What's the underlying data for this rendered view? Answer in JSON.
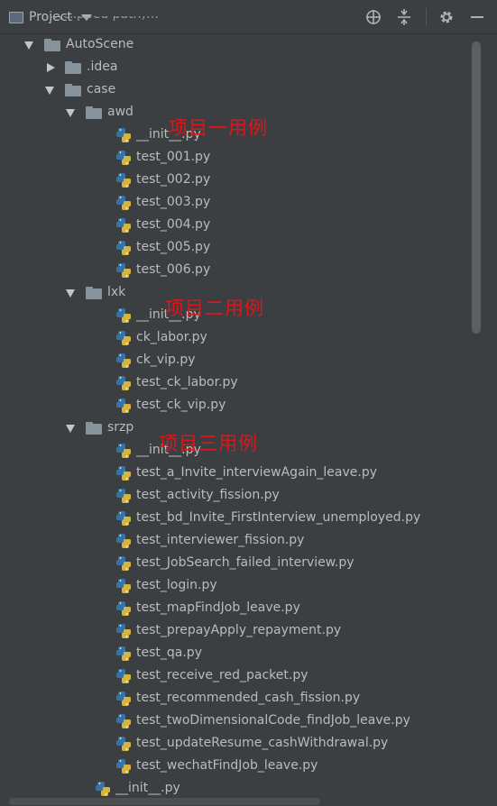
{
  "toolbar": {
    "title": "Project",
    "icons": [
      "crosshair-icon",
      "collapse-icon",
      "gear-icon",
      "minimize-icon"
    ]
  },
  "tree": {
    "hidden_top_row": "…(clipped path)…",
    "rows": [
      {
        "label": "AutoScene",
        "kind": "folder",
        "expanded": true
      },
      {
        "label": ".idea",
        "kind": "folder",
        "expanded": false
      },
      {
        "label": "case",
        "kind": "folder",
        "expanded": true
      },
      {
        "label": "awd",
        "kind": "folder",
        "expanded": true
      },
      {
        "label": "__init__.py",
        "kind": "py"
      },
      {
        "label": "test_001.py",
        "kind": "py"
      },
      {
        "label": "test_002.py",
        "kind": "py"
      },
      {
        "label": "test_003.py",
        "kind": "py"
      },
      {
        "label": "test_004.py",
        "kind": "py"
      },
      {
        "label": "test_005.py",
        "kind": "py"
      },
      {
        "label": "test_006.py",
        "kind": "py"
      },
      {
        "label": "lxk",
        "kind": "folder",
        "expanded": true
      },
      {
        "label": "__init__.py",
        "kind": "py"
      },
      {
        "label": "ck_labor.py",
        "kind": "py"
      },
      {
        "label": "ck_vip.py",
        "kind": "py"
      },
      {
        "label": "test_ck_labor.py",
        "kind": "py"
      },
      {
        "label": "test_ck_vip.py",
        "kind": "py"
      },
      {
        "label": "srzp",
        "kind": "folder",
        "expanded": true
      },
      {
        "label": "__init__.py",
        "kind": "py"
      },
      {
        "label": "test_a_Invite_interviewAgain_leave.py",
        "kind": "py"
      },
      {
        "label": "test_activity_fission.py",
        "kind": "py"
      },
      {
        "label": "test_bd_Invite_FirstInterview_unemployed.py",
        "kind": "py"
      },
      {
        "label": "test_interviewer_fission.py",
        "kind": "py"
      },
      {
        "label": "test_JobSearch_failed_interview.py",
        "kind": "py"
      },
      {
        "label": "test_login.py",
        "kind": "py"
      },
      {
        "label": "test_mapFindJob_leave.py",
        "kind": "py"
      },
      {
        "label": "test_prepayApply_repayment.py",
        "kind": "py"
      },
      {
        "label": "test_qa.py",
        "kind": "py"
      },
      {
        "label": "test_receive_red_packet.py",
        "kind": "py"
      },
      {
        "label": "test_recommended_cash_fission.py",
        "kind": "py"
      },
      {
        "label": "test_twoDimensionalCode_findJob_leave.py",
        "kind": "py"
      },
      {
        "label": "test_updateResume_cashWithdrawal.py",
        "kind": "py"
      },
      {
        "label": "test_wechatFindJob_leave.py",
        "kind": "py"
      },
      {
        "label": "__init__.py",
        "kind": "py"
      }
    ]
  },
  "annotations": {
    "awd": "项目一用例",
    "lxk": "项目二用例",
    "srzp": "项目三用例"
  },
  "colors": {
    "background": "#3c3f41",
    "text": "#bbbbbb",
    "annotation": "#e0141b",
    "folder": "#87939a"
  }
}
